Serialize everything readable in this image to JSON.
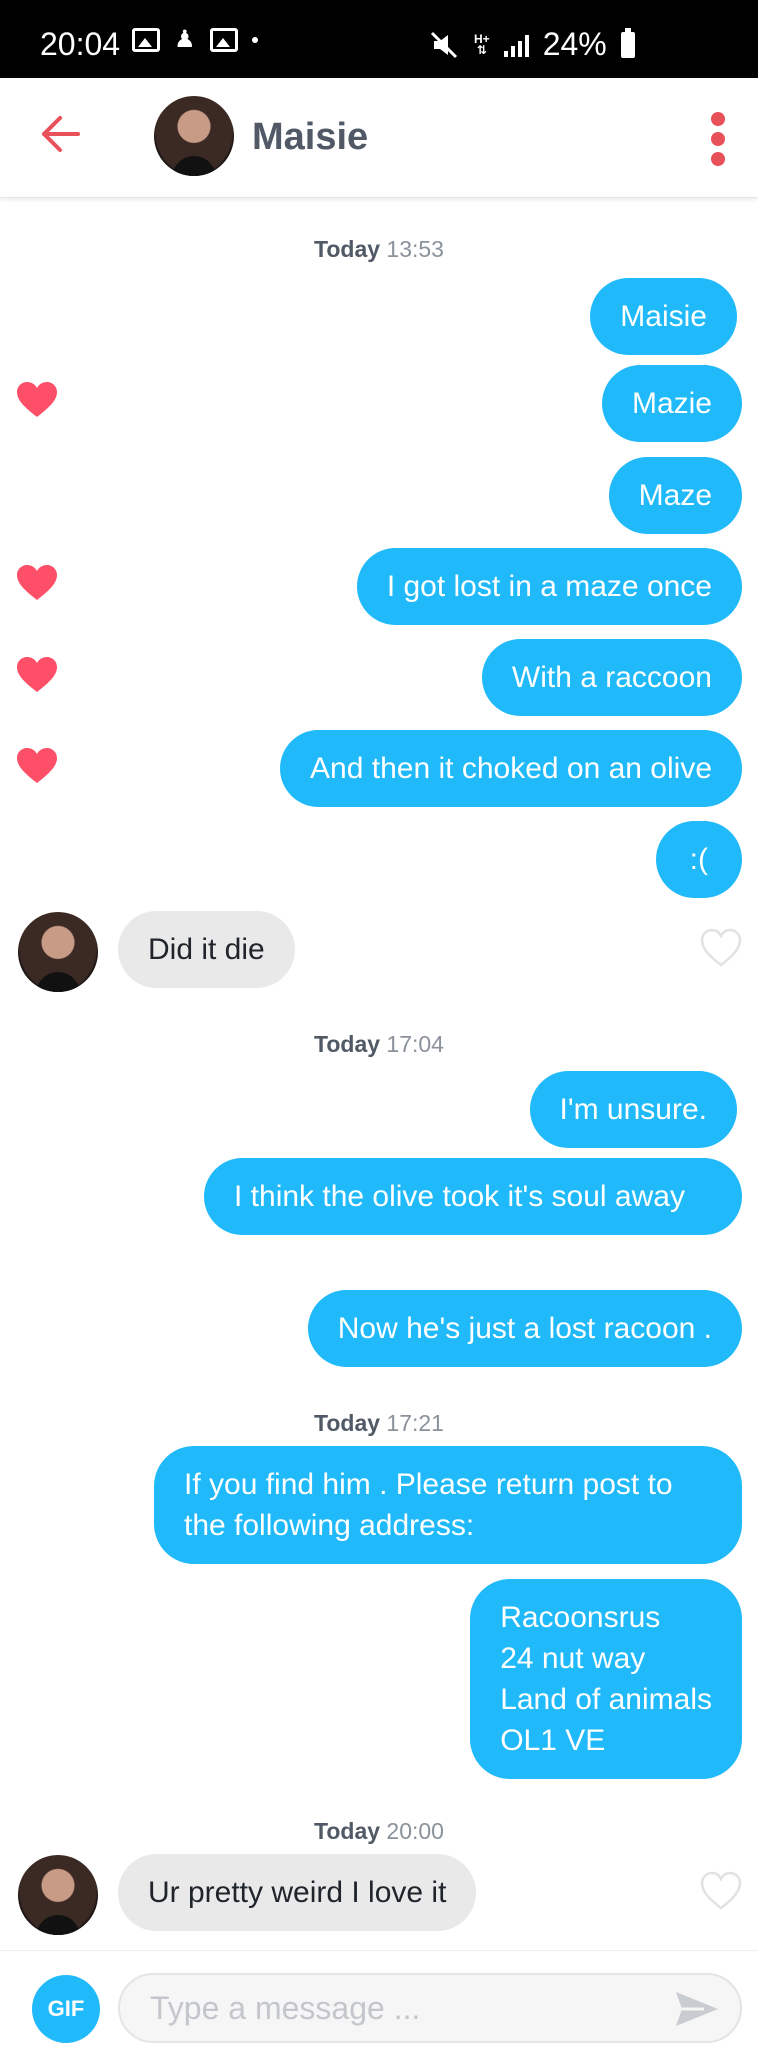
{
  "status_bar": {
    "time": "20:04",
    "battery": "24%",
    "network": "H+"
  },
  "header": {
    "name": "Maisie"
  },
  "timestamps": [
    {
      "day": "Today",
      "time": "13:53"
    },
    {
      "day": "Today",
      "time": "17:04"
    },
    {
      "day": "Today",
      "time": "17:21"
    },
    {
      "day": "Today",
      "time": "20:00"
    }
  ],
  "messages": [
    {
      "from": "me",
      "text": "Maisie",
      "liked": false
    },
    {
      "from": "me",
      "text": "Mazie",
      "liked": true
    },
    {
      "from": "me",
      "text": "Maze",
      "liked": false
    },
    {
      "from": "me",
      "text": "I got lost in a maze once",
      "liked": true
    },
    {
      "from": "me",
      "text": "With a raccoon",
      "liked": true
    },
    {
      "from": "me",
      "text": "And then it choked on an olive",
      "liked": true
    },
    {
      "from": "me",
      "text": ":(",
      "liked": false
    },
    {
      "from": "them",
      "text": "Did it die",
      "liked": false
    },
    {
      "from": "me",
      "text": "I'm unsure.",
      "liked": false
    },
    {
      "from": "me",
      "text": "I think the olive took it's soul away",
      "liked": false
    },
    {
      "from": "me",
      "text": "Now he's just a lost racoon .",
      "liked": false
    },
    {
      "from": "me",
      "text": "If you find him . Please return post to the following address:",
      "liked": false
    },
    {
      "from": "me",
      "text": "Racoonsrus\n24 nut way\nLand of animals\nOL1 VE",
      "liked": false
    },
    {
      "from": "them",
      "text": "Ur pretty weird I love it",
      "liked": false
    }
  ],
  "input": {
    "gif_label": "GIF",
    "placeholder": "Type a message ..."
  },
  "colors": {
    "outgoing_bubble": "#20b9f9",
    "incoming_bubble": "#e9e9ea",
    "heart": "#fd5068",
    "accent": "#e9515a"
  }
}
